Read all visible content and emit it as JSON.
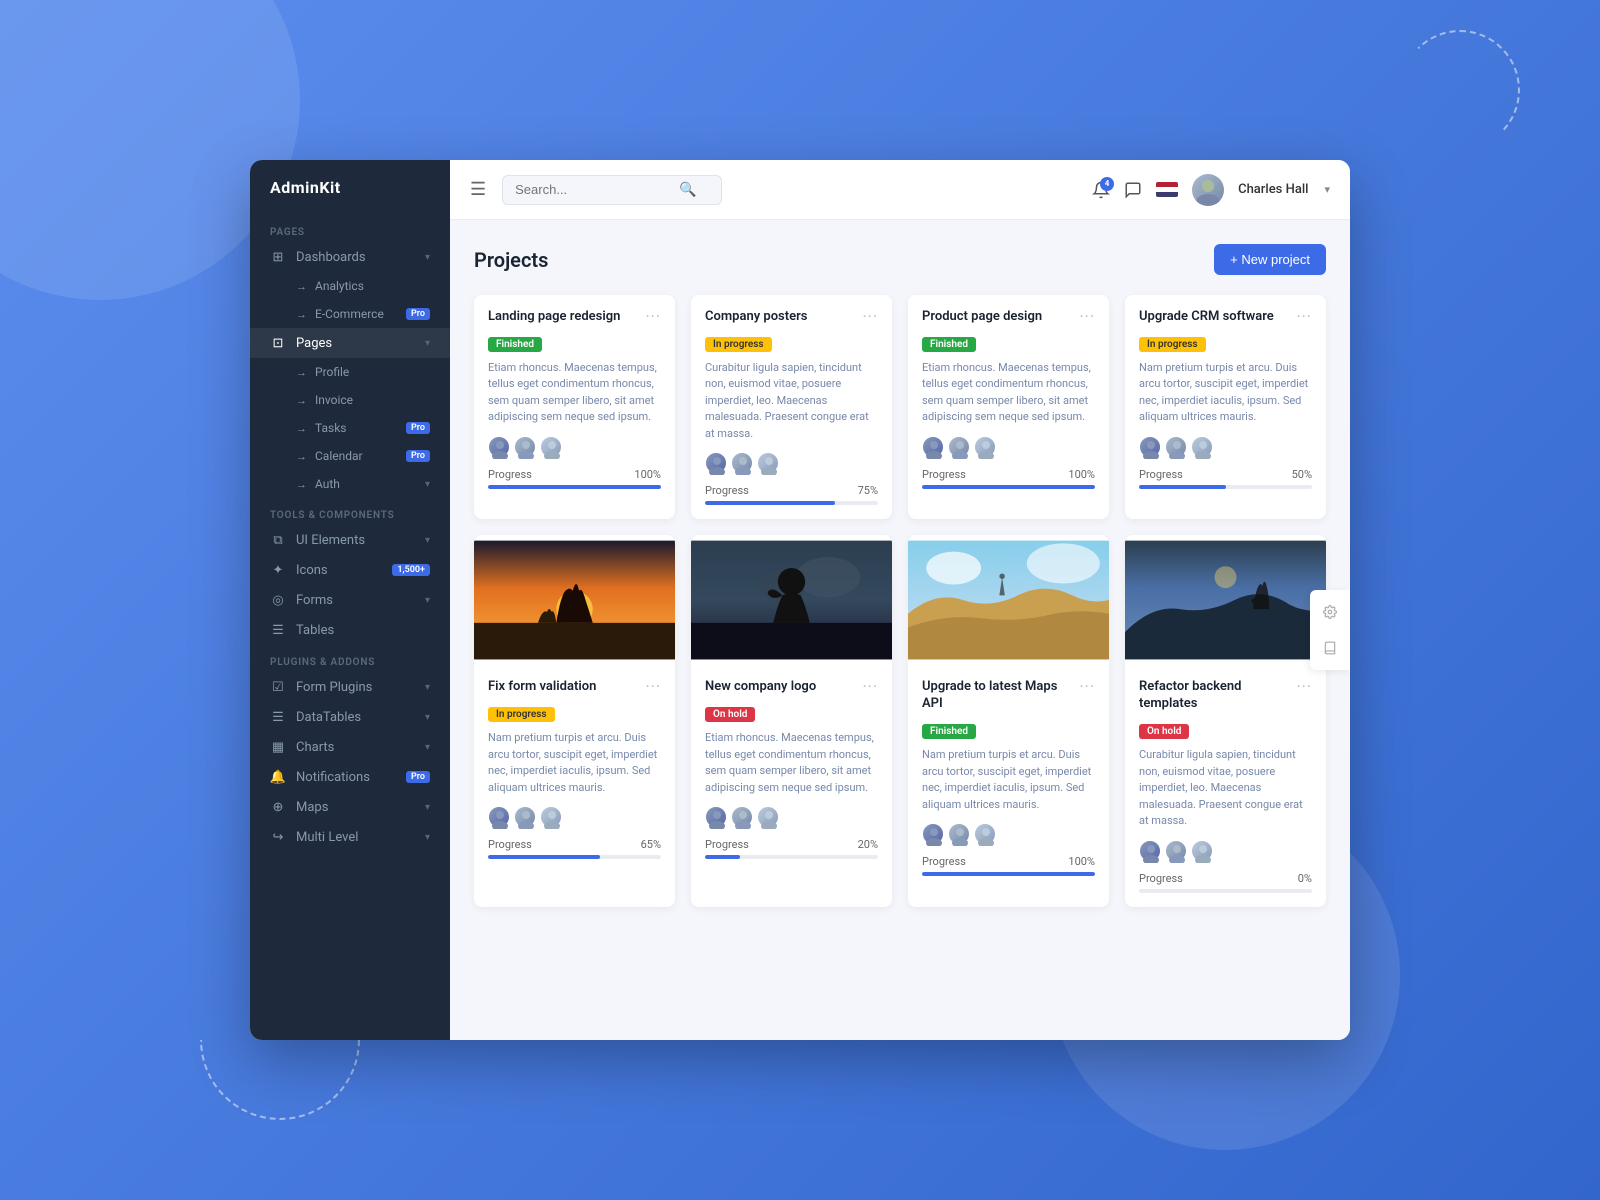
{
  "app": {
    "brand": "AdminKit",
    "accent_color": "#3d6be8"
  },
  "sidebar": {
    "sections": [
      {
        "label": "Pages",
        "items": [
          {
            "id": "dashboards",
            "label": "Dashboards",
            "icon": "grid",
            "hasChevron": true,
            "badge": null
          },
          {
            "id": "analytics",
            "label": "Analytics",
            "icon": "arrow",
            "sub": true,
            "badge": null
          },
          {
            "id": "ecommerce",
            "label": "E-Commerce",
            "icon": "arrow",
            "sub": true,
            "badge": "Pro"
          },
          {
            "id": "pages",
            "label": "Pages",
            "icon": "layout",
            "active": true,
            "hasChevron": true,
            "badge": null
          },
          {
            "id": "profile",
            "label": "Profile",
            "icon": "user",
            "sub": false,
            "indent": true,
            "badge": null
          },
          {
            "id": "invoice",
            "label": "Invoice",
            "icon": "credit-card",
            "indent": true,
            "badge": null
          },
          {
            "id": "tasks",
            "label": "Tasks",
            "indent": true,
            "badge": "Pro"
          },
          {
            "id": "calendar",
            "label": "Calendar",
            "indent": true,
            "badge": "Pro"
          },
          {
            "id": "auth",
            "label": "Auth",
            "indent": true,
            "hasChevron": true,
            "badge": null
          }
        ]
      },
      {
        "label": "Tools & Components",
        "items": [
          {
            "id": "ui-elements",
            "label": "UI Elements",
            "icon": "layers",
            "hasChevron": true,
            "badge": null
          },
          {
            "id": "icons",
            "label": "Icons",
            "icon": "star",
            "badge": "1,500+",
            "badgeColor": "#3d6be8"
          },
          {
            "id": "forms",
            "label": "Forms",
            "icon": "check-circle",
            "hasChevron": true,
            "badge": null
          },
          {
            "id": "tables",
            "label": "Tables",
            "icon": "list",
            "badge": null
          }
        ]
      },
      {
        "label": "Plugins & Addons",
        "items": [
          {
            "id": "form-plugins",
            "label": "Form Plugins",
            "icon": "check-square",
            "hasChevron": true,
            "badge": null
          },
          {
            "id": "datatables",
            "label": "DataTables",
            "icon": "list",
            "hasChevron": true,
            "badge": null
          },
          {
            "id": "charts",
            "label": "Charts",
            "icon": "bar-chart",
            "hasChevron": true,
            "badge": null
          },
          {
            "id": "notifications",
            "label": "Notifications",
            "icon": "bell",
            "badge": "Pro"
          },
          {
            "id": "maps",
            "label": "Maps",
            "icon": "map",
            "hasChevron": true,
            "badge": null
          },
          {
            "id": "multi-level",
            "label": "Multi Level",
            "icon": "chevron-right2",
            "hasChevron": true,
            "badge": null
          }
        ]
      }
    ]
  },
  "header": {
    "search_placeholder": "Search...",
    "notification_count": "4",
    "user_name": "Charles Hall",
    "user_dropdown_icon": "▾"
  },
  "main": {
    "title": "Projects",
    "new_project_label": "+ New project",
    "projects": [
      {
        "id": 1,
        "title": "Landing page redesign",
        "status": "Finished",
        "status_class": "status-finished",
        "description": "Etiam rhoncus. Maecenas tempus, tellus eget condimentum rhoncus, sem quam semper libero, sit amet adipiscing sem neque sed ipsum.",
        "progress": 100,
        "progress_label": "Progress",
        "has_image": false
      },
      {
        "id": 2,
        "title": "Company posters",
        "status": "In progress",
        "status_class": "status-in-progress",
        "description": "Curabitur ligula sapien, tincidunt non, euismod vitae, posuere imperdiet, leo. Maecenas malesuada. Praesent congue erat at massa.",
        "progress": 75,
        "progress_label": "Progress",
        "has_image": false
      },
      {
        "id": 3,
        "title": "Product page design",
        "status": "Finished",
        "status_class": "status-finished",
        "description": "Etiam rhoncus. Maecenas tempus, tellus eget condimentum rhoncus, sem quam semper libero, sit amet adipiscing sem neque sed ipsum.",
        "progress": 100,
        "progress_label": "Progress",
        "has_image": false
      },
      {
        "id": 4,
        "title": "Upgrade CRM software",
        "status": "In progress",
        "status_class": "status-in-progress",
        "description": "Nam pretium turpis et arcu. Duis arcu tortor, suscipit eget, imperdiet nec, imperdiet iaculis, ipsum. Sed aliquam ultrices mauris.",
        "progress": 50,
        "progress_label": "Progress",
        "has_image": false
      },
      {
        "id": 5,
        "title": "Fix form validation",
        "status": "In progress",
        "status_class": "status-in-progress",
        "description": "Nam pretium turpis et arcu. Duis arcu tortor, suscipit eget, imperdiet nec, imperdiet iaculis, ipsum. Sed aliquam ultrices mauris.",
        "progress": 65,
        "progress_label": "Progress",
        "has_image": true,
        "image_gradient": "linear-gradient(135deg, #e8a87c 0%, #8b5e3c 30%, #2c3e50 100%)"
      },
      {
        "id": 6,
        "title": "New company logo",
        "status": "On hold",
        "status_class": "status-on-hold",
        "description": "Etiam rhoncus. Maecenas tempus, tellus eget condimentum rhoncus, sem quam semper libero, sit amet adipiscing sem neque sed ipsum.",
        "progress": 20,
        "progress_label": "Progress",
        "has_image": true,
        "image_gradient": "linear-gradient(135deg, #3a3a3a 0%, #1a1a2e 100%)"
      },
      {
        "id": 7,
        "title": "Upgrade to latest Maps API",
        "status": "Finished",
        "status_class": "status-finished",
        "description": "Nam pretium turpis et arcu. Duis arcu tortor, suscipit eget, imperdiet nec, imperdiet iaculis, ipsum. Sed aliquam ultrices mauris.",
        "progress": 100,
        "progress_label": "Progress",
        "has_image": true,
        "image_gradient": "linear-gradient(135deg, #c8a96e 0%, #8b7355 50%, #5a8fa8 100%)"
      },
      {
        "id": 8,
        "title": "Refactor backend templates",
        "status": "On hold",
        "status_class": "status-on-hold",
        "description": "Curabitur ligula sapien, tincidunt non, euismod vitae, posuere imperdiet, leo. Maecenas malesuada. Praesent congue erat at massa.",
        "progress": 0,
        "progress_label": "Progress",
        "has_image": true,
        "image_gradient": "linear-gradient(135deg, #2c3e50 0%, #4a6fa5 50%, #6b8cba 100%)"
      }
    ]
  }
}
